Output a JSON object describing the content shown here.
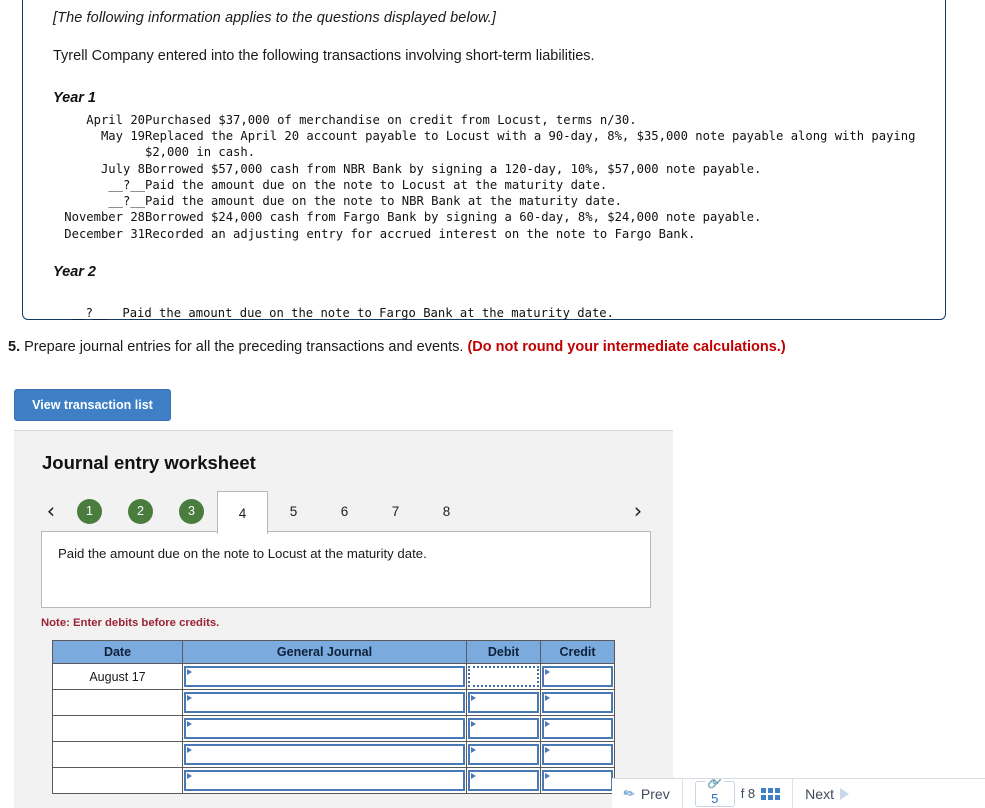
{
  "info_box": {
    "italic_note": "[The following information applies to the questions displayed below.]",
    "intro": "Tyrell Company entered into the following transactions involving short-term liabilities.",
    "year1_label": "Year 1",
    "year1_transactions": [
      {
        "date": "April 20",
        "description": "Purchased $37,000 of merchandise on credit from Locust, terms n/30."
      },
      {
        "date": "May 19",
        "description": "Replaced the April 20 account payable to Locust with a 90-day, 8%, $35,000 note payable along with paying\n$2,000 in cash."
      },
      {
        "date": "July 8",
        "description": "Borrowed $57,000 cash from NBR Bank by signing a 120-day, 10%, $57,000 note payable."
      },
      {
        "date": "__?__",
        "description": "Paid the amount due on the note to Locust at the maturity date."
      },
      {
        "date": "__?__",
        "description": "Paid the amount due on the note to NBR Bank at the maturity date."
      },
      {
        "date": "November 28",
        "description": "Borrowed $24,000 cash from Fargo Bank by signing a 60-day, 8%, $24,000 note payable."
      },
      {
        "date": "December 31",
        "description": "Recorded an adjusting entry for accrued interest on the note to Fargo Bank."
      }
    ],
    "year2_label": "Year 2",
    "year2_transaction": "__?__  Paid the amount due on the note to Fargo Bank at the maturity date."
  },
  "question": {
    "number": "5.",
    "text": " Prepare journal entries for all the preceding transactions and events. ",
    "warning": "(Do not round your intermediate calculations.)"
  },
  "view_button": {
    "label": "View transaction list"
  },
  "worksheet": {
    "title": "Journal entry worksheet",
    "prev_chevron": "‹",
    "next_chevron": "›",
    "tabs": [
      {
        "label": "1",
        "state": "completed"
      },
      {
        "label": "2",
        "state": "completed"
      },
      {
        "label": "3",
        "state": "completed"
      },
      {
        "label": "4",
        "state": "active"
      },
      {
        "label": "5",
        "state": "inactive"
      },
      {
        "label": "6",
        "state": "inactive"
      },
      {
        "label": "7",
        "state": "inactive"
      },
      {
        "label": "8",
        "state": "inactive"
      }
    ],
    "description": "Paid the amount due on the note to Locust at the maturity date.",
    "note": "Note: Enter debits before credits.",
    "table": {
      "headers": [
        "Date",
        "General Journal",
        "Debit",
        "Credit"
      ],
      "rows": [
        {
          "date": "August 17",
          "general_journal": "",
          "debit": "",
          "credit": ""
        },
        {
          "date": "",
          "general_journal": "",
          "debit": "",
          "credit": ""
        },
        {
          "date": "",
          "general_journal": "",
          "debit": "",
          "credit": ""
        },
        {
          "date": "",
          "general_journal": "",
          "debit": "",
          "credit": ""
        },
        {
          "date": "",
          "general_journal": "",
          "debit": "",
          "credit": ""
        }
      ]
    }
  },
  "footer": {
    "prev_label": "Prev",
    "page_value": "5",
    "of_label": "f 8",
    "next_label": "Next"
  },
  "colors": {
    "button_blue": "#3f7fc6",
    "table_header_blue": "#7aaade",
    "completed_green": "#4a7c3e",
    "warning_red": "#c00000",
    "note_red": "#9b2335",
    "box_border_navy": "#16396b"
  }
}
